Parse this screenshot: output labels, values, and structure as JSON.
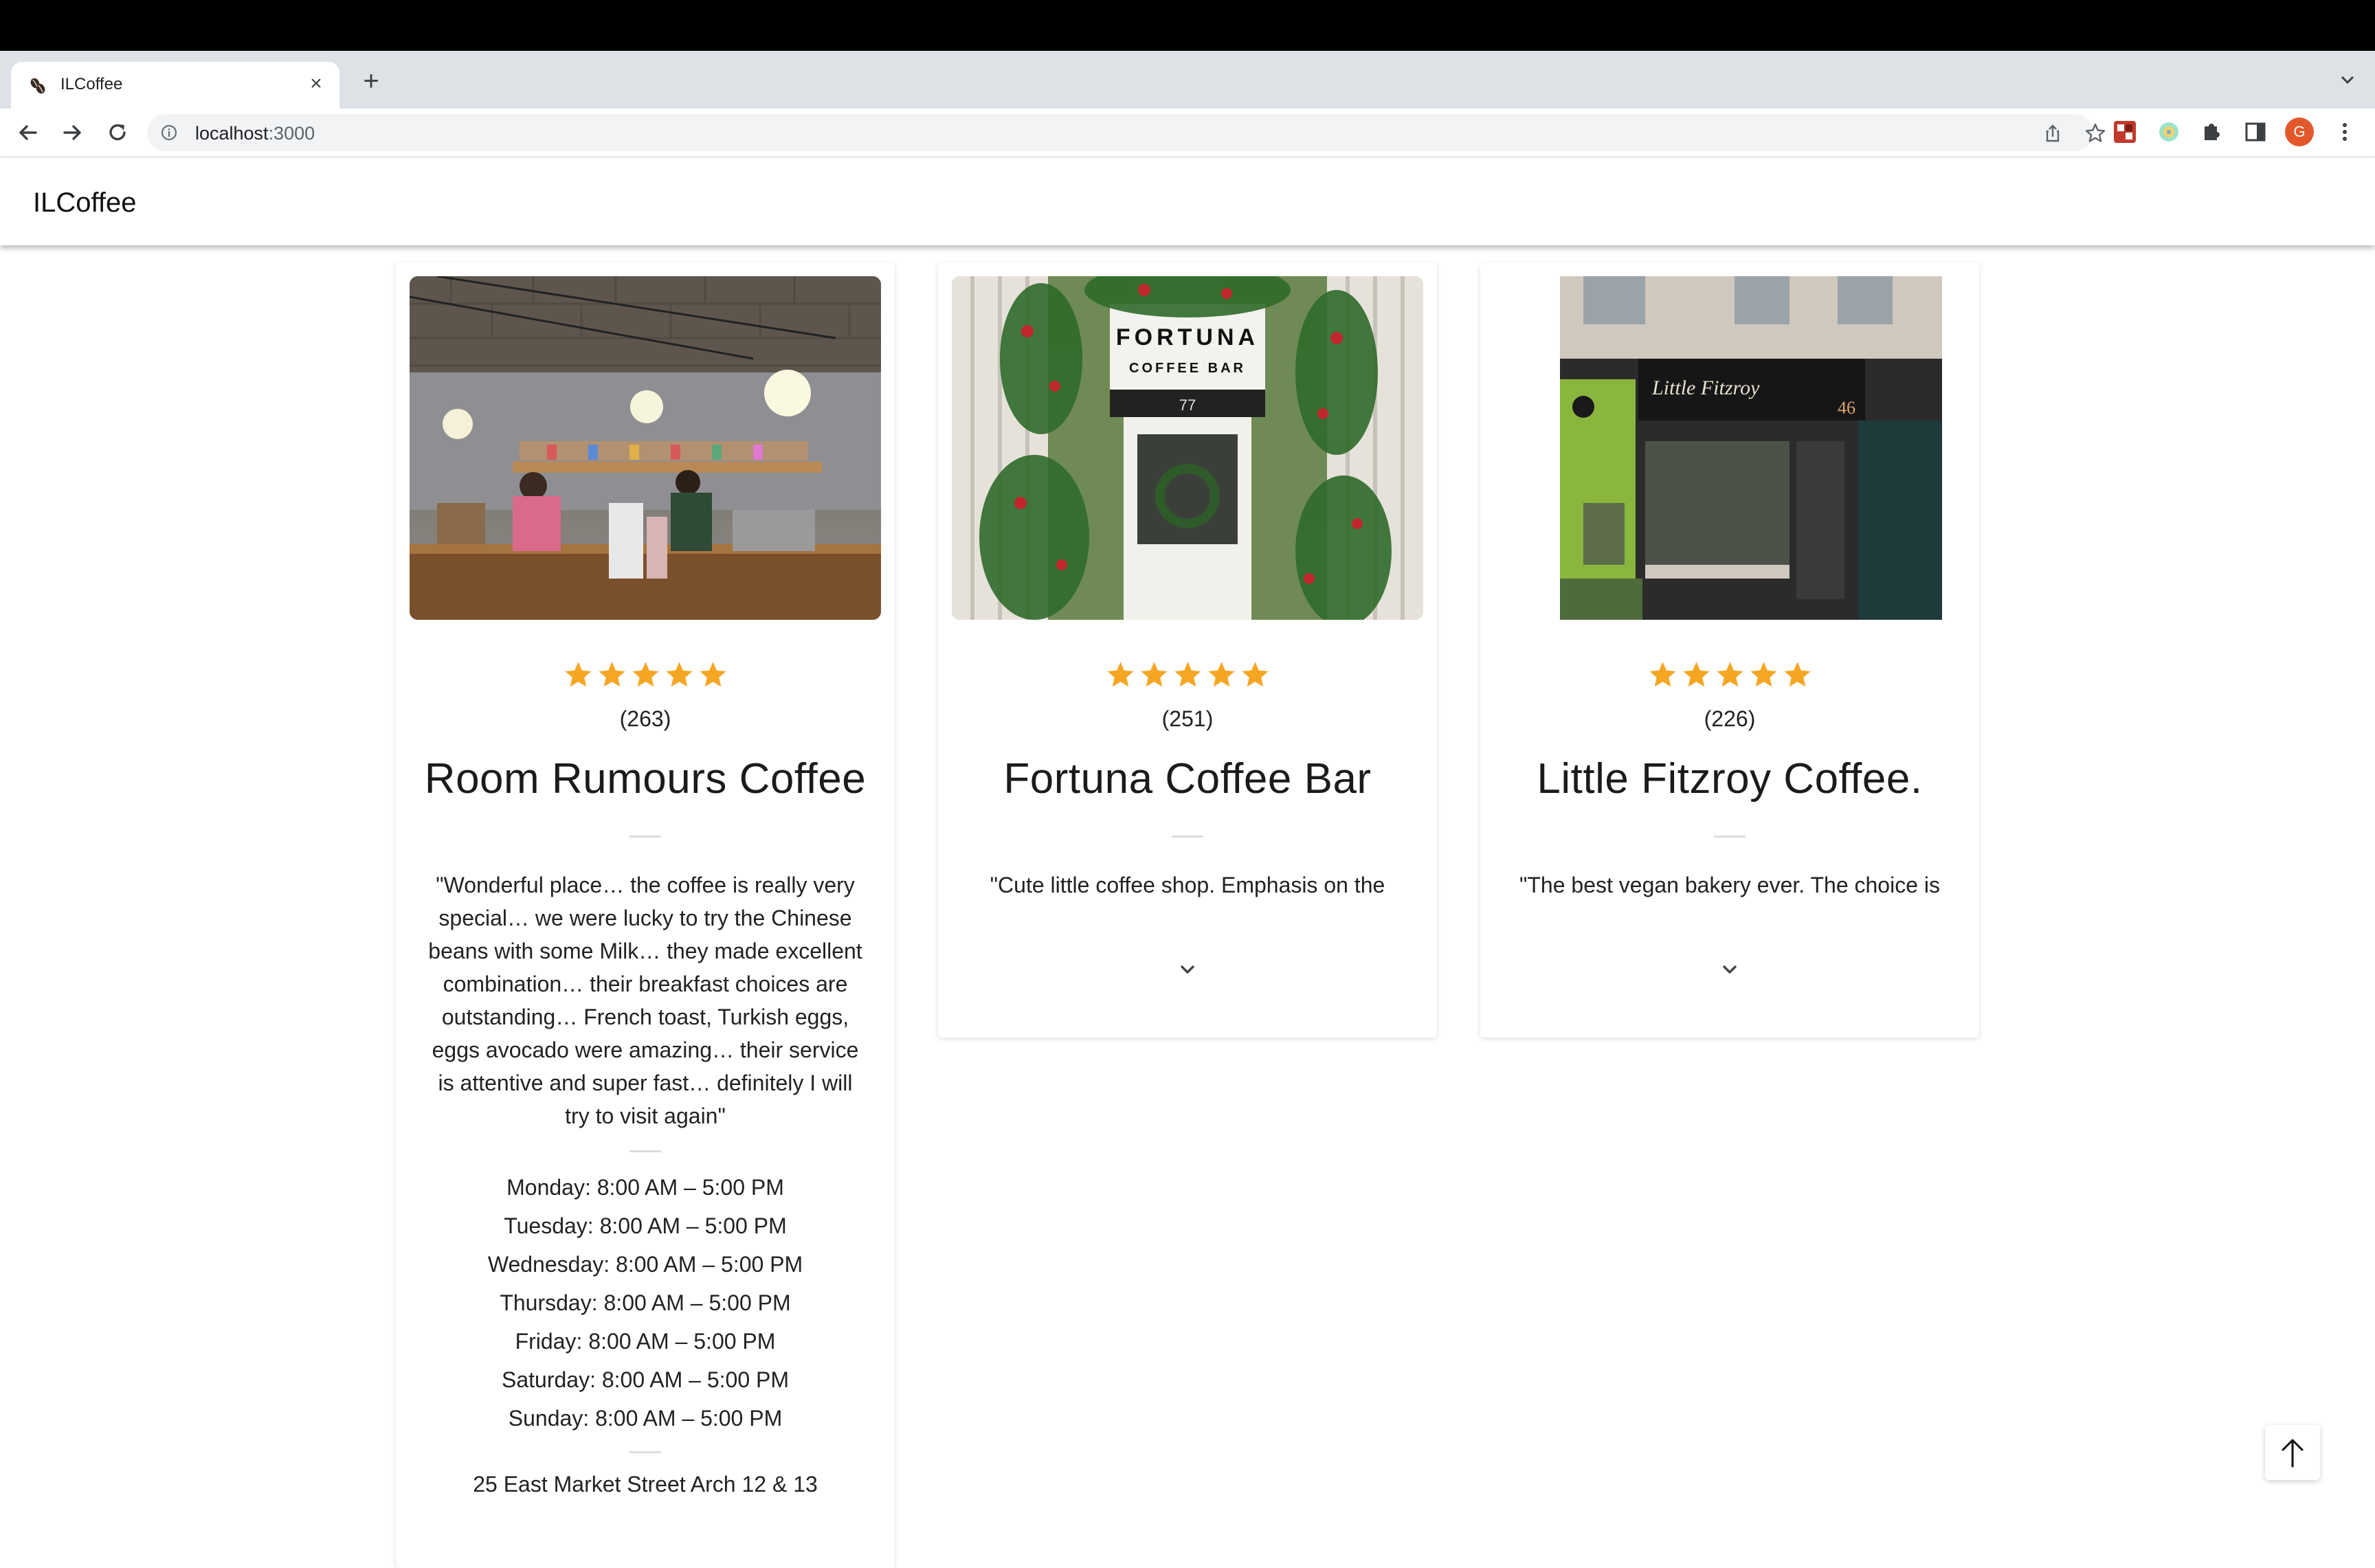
{
  "browser": {
    "tab_title": "ILCoffee",
    "url_host": "localhost",
    "url_port": ":3000",
    "avatar_letter": "G"
  },
  "app": {
    "title": "ILCoffee"
  },
  "colors": {
    "star": "#f5a623",
    "avatar": "#e2582b"
  },
  "cards": [
    {
      "image_icon": "cafe-interior-photo",
      "rating": 5,
      "rating_count": "(263)",
      "name": "Room Rumours Coffee",
      "review": "\"Wonderful place… the coffee is really very special… we were lucky to try the Chinese beans with some Milk… they made excellent combination… their breakfast choices are outstanding… French toast, Turkish eggs, eggs avocado were amazing… their service is attentive and super fast… definitely I will try to visit again\"",
      "hours": [
        "Monday: 8:00 AM – 5:00 PM",
        "Tuesday: 8:00 AM – 5:00 PM",
        "Wednesday: 8:00 AM – 5:00 PM",
        "Thursday: 8:00 AM – 5:00 PM",
        "Friday: 8:00 AM – 5:00 PM",
        "Saturday: 8:00 AM – 5:00 PM",
        "Sunday: 8:00 AM – 5:00 PM"
      ],
      "address": "25 East Market Street Arch 12 & 13"
    },
    {
      "image_icon": "cafe-storefront-photo",
      "rating": 5,
      "rating_count": "(251)",
      "name": "Fortuna Coffee Bar",
      "review": "\"Cute little coffee shop. Emphasis on the “little” - so if you want to dine in be prepared"
    },
    {
      "image_icon": "cafe-facade-photo",
      "rating": 5,
      "rating_count": "(226)",
      "name": "Little Fitzroy Coffee.",
      "review": "\"The best vegan bakery ever. The choice is very large and it changes quite frequently"
    }
  ],
  "photo_signs": {
    "fortuna_line1": "FORTUNA",
    "fortuna_line2": "COFFEE BAR",
    "fortuna_number": "77",
    "fitzroy_sign": "Little Fitzroy",
    "fitzroy_number": "46"
  }
}
